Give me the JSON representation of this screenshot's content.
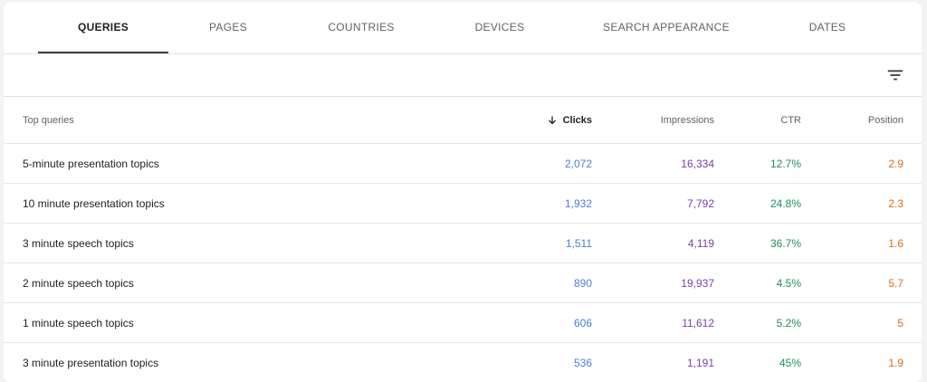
{
  "tabs": [
    {
      "label": "QUERIES",
      "active": true
    },
    {
      "label": "PAGES",
      "active": false
    },
    {
      "label": "COUNTRIES",
      "active": false
    },
    {
      "label": "DEVICES",
      "active": false
    },
    {
      "label": "SEARCH APPEARANCE",
      "active": false
    },
    {
      "label": "DATES",
      "active": false
    }
  ],
  "table": {
    "headers": {
      "query": "Top queries",
      "clicks": "Clicks",
      "impressions": "Impressions",
      "ctr": "CTR",
      "position": "Position"
    },
    "rows": [
      {
        "query": "5-minute presentation topics",
        "clicks": "2,072",
        "impressions": "16,334",
        "ctr": "12.7%",
        "position": "2.9"
      },
      {
        "query": "10 minute presentation topics",
        "clicks": "1,932",
        "impressions": "7,792",
        "ctr": "24.8%",
        "position": "2.3"
      },
      {
        "query": "3 minute speech topics",
        "clicks": "1,511",
        "impressions": "4,119",
        "ctr": "36.7%",
        "position": "1.6"
      },
      {
        "query": "2 minute speech topics",
        "clicks": "890",
        "impressions": "19,937",
        "ctr": "4.5%",
        "position": "5.7"
      },
      {
        "query": "1 minute speech topics",
        "clicks": "606",
        "impressions": "11,612",
        "ctr": "5.2%",
        "position": "5"
      },
      {
        "query": "3 minute presentation topics",
        "clicks": "536",
        "impressions": "1,191",
        "ctr": "45%",
        "position": "1.9"
      }
    ]
  },
  "colors": {
    "clicks": "#4a7fd1",
    "impressions": "#7b3fa8",
    "ctr": "#1e8e5a",
    "position": "#d46f1c"
  },
  "icons": {
    "filter": "filter-list-icon",
    "sort": "arrow-down-icon"
  }
}
